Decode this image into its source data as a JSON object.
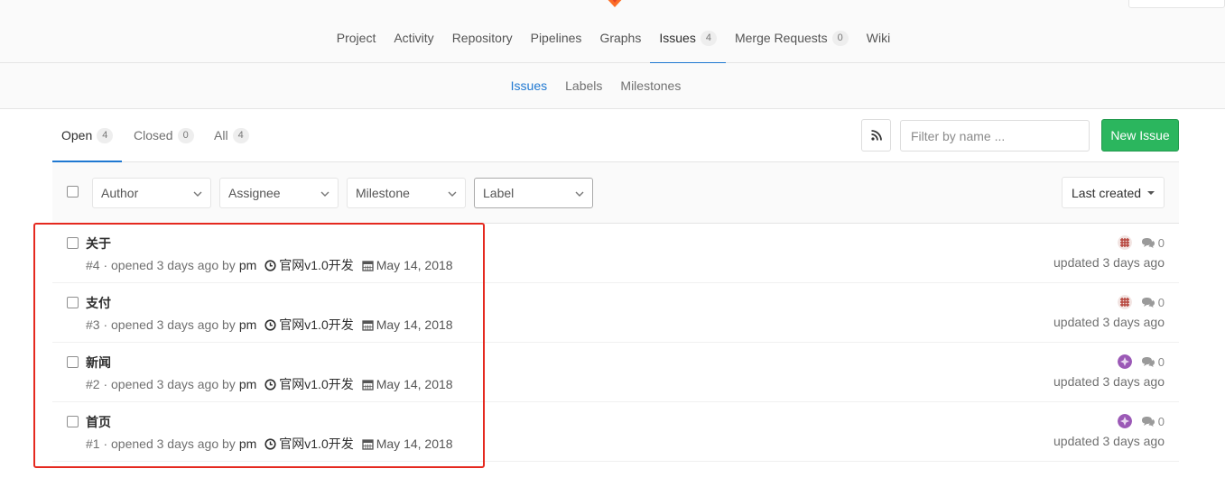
{
  "nav": {
    "items": [
      {
        "label": "Project"
      },
      {
        "label": "Activity"
      },
      {
        "label": "Repository"
      },
      {
        "label": "Pipelines"
      },
      {
        "label": "Graphs"
      },
      {
        "label": "Issues",
        "count": "4",
        "active": true
      },
      {
        "label": "Merge Requests",
        "count": "0"
      },
      {
        "label": "Wiki"
      }
    ]
  },
  "subnav": {
    "items": [
      {
        "label": "Issues",
        "active": true
      },
      {
        "label": "Labels"
      },
      {
        "label": "Milestones"
      }
    ]
  },
  "state_tabs": {
    "open": {
      "label": "Open",
      "count": "4"
    },
    "closed": {
      "label": "Closed",
      "count": "0"
    },
    "all": {
      "label": "All",
      "count": "4"
    }
  },
  "search": {
    "placeholder": "Filter by name ..."
  },
  "new_issue_label": "New Issue",
  "filters": {
    "author": "Author",
    "assignee": "Assignee",
    "milestone": "Milestone",
    "label": "Label",
    "sort": "Last created"
  },
  "issues": [
    {
      "title": "关于",
      "ref": "#4",
      "opened": "· opened 3 days ago by",
      "author": "pm",
      "milestone": "官网v1.0开发",
      "due": "May 14, 2018",
      "comments": "0",
      "updated": "updated 3 days ago",
      "avatar_color": "#b5423a"
    },
    {
      "title": "支付",
      "ref": "#3",
      "opened": "· opened 3 days ago by",
      "author": "pm",
      "milestone": "官网v1.0开发",
      "due": "May 14, 2018",
      "comments": "0",
      "updated": "updated 3 days ago",
      "avatar_color": "#b5423a"
    },
    {
      "title": "新闻",
      "ref": "#2",
      "opened": "· opened 3 days ago by",
      "author": "pm",
      "milestone": "官网v1.0开发",
      "due": "May 14, 2018",
      "comments": "0",
      "updated": "updated 3 days ago",
      "avatar_color": "#9b59b6"
    },
    {
      "title": "首页",
      "ref": "#1",
      "opened": "· opened 3 days ago by",
      "author": "pm",
      "milestone": "官网v1.0开发",
      "due": "May 14, 2018",
      "comments": "0",
      "updated": "updated 3 days ago",
      "avatar_color": "#9b59b6"
    }
  ],
  "colors": {
    "accent": "#1f78d1",
    "success": "#2bb65e",
    "highlight": "#e5291f"
  },
  "icons": {
    "rss": "rss-icon",
    "milestone": "clock-icon",
    "due": "calendar-icon",
    "comments": "comments-icon"
  }
}
